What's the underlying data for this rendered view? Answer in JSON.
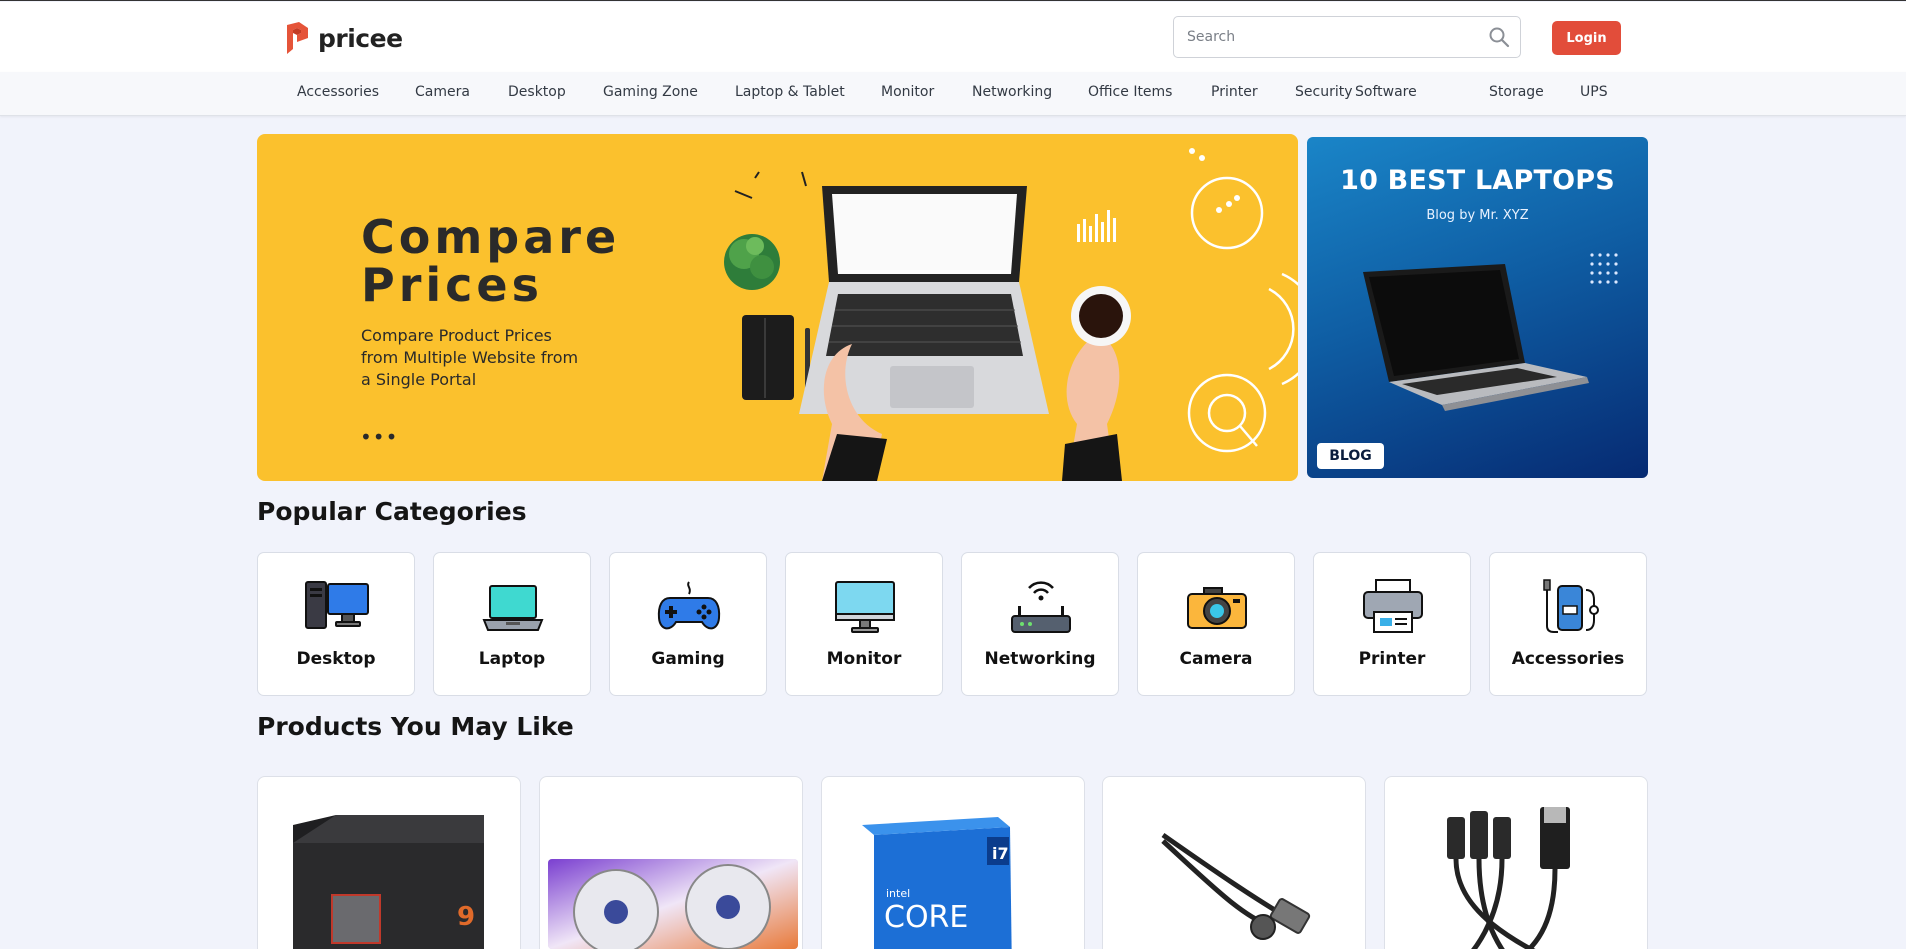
{
  "header": {
    "logo_text": "pricee",
    "search": {
      "placeholder": "Search"
    },
    "login_label": "Login"
  },
  "nav": {
    "items": [
      "Accessories",
      "Camera",
      "Desktop",
      "Gaming Zone",
      "Laptop & Tablet",
      "Monitor",
      "Networking",
      "Office Items",
      "Printer",
      "Security",
      "Software",
      "Storage",
      "UPS"
    ]
  },
  "hero": {
    "title_line1": "Compare",
    "title_line2": "Prices",
    "subtitle": "Compare Product Prices from Multiple Website from a Single Portal",
    "dots": "•••",
    "background_color": "#fbc12d"
  },
  "blog": {
    "title": "10 BEST LAPTOPS",
    "subtitle": "Blog by Mr. XYZ",
    "tag": "BLOG"
  },
  "sections": {
    "popular_categories": "Popular Categories",
    "products_you_may_like": "Products You May Like"
  },
  "categories": [
    {
      "label": "Desktop",
      "icon": "desktop-icon"
    },
    {
      "label": "Laptop",
      "icon": "laptop-icon"
    },
    {
      "label": "Gaming",
      "icon": "gamepad-icon"
    },
    {
      "label": "Monitor",
      "icon": "monitor-icon"
    },
    {
      "label": "Networking",
      "icon": "router-icon"
    },
    {
      "label": "Camera",
      "icon": "camera-icon"
    },
    {
      "label": "Printer",
      "icon": "printer-icon"
    },
    {
      "label": "Accessories",
      "icon": "accessories-icon"
    }
  ],
  "products": [
    {
      "image": "processor-box-image"
    },
    {
      "image": "graphics-card-image"
    },
    {
      "image": "intel-core-i7-box-image"
    },
    {
      "image": "magnetic-usb-cable-image"
    },
    {
      "image": "three-in-one-usb-cable-image"
    }
  ],
  "colors": {
    "accent": "#e24d3a",
    "page_background": "#f1f3fb",
    "blog_blue": "#0f5ea4"
  }
}
